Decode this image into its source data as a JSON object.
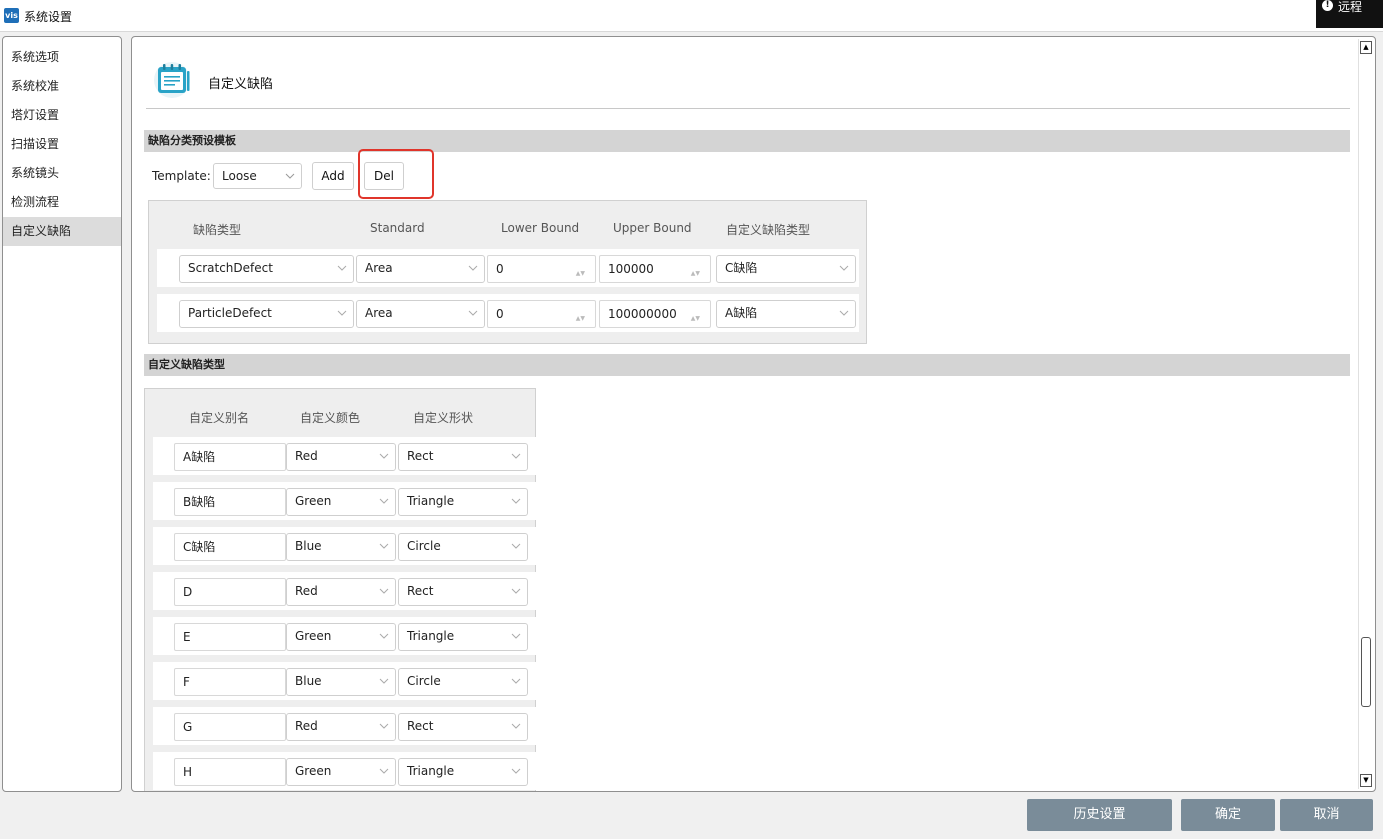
{
  "window": {
    "title": "系统设置",
    "app_icon": "vis",
    "remote_badge": "远程"
  },
  "nav": {
    "items": [
      "系统选项",
      "系统校准",
      "塔灯设置",
      "扫描设置",
      "系统镜头",
      "检测流程",
      "自定义缺陷"
    ],
    "active_index": 6
  },
  "header": {
    "title": "自定义缺陷",
    "icon": "notepad-icon"
  },
  "preset_section": {
    "title": "缺陷分类预设模板",
    "template_label": "Template:",
    "template_value": "Loose",
    "add_label": "Add",
    "del_label": "Del",
    "columns": [
      "缺陷类型",
      "Standard",
      "Lower Bound",
      "Upper Bound",
      "自定义缺陷类型"
    ],
    "rows": [
      {
        "defect_type": "ScratchDefect",
        "standard": "Area",
        "lower": "0",
        "upper": "100000",
        "custom_type": "C缺陷"
      },
      {
        "defect_type": "ParticleDefect",
        "standard": "Area",
        "lower": "0",
        "upper": "100000000",
        "custom_type": "A缺陷"
      }
    ]
  },
  "custom_section": {
    "title": "自定义缺陷类型",
    "columns": [
      "自定义别名",
      "自定义颜色",
      "自定义形状"
    ],
    "rows": [
      {
        "alias": "A缺陷",
        "color": "Red",
        "shape": "Rect"
      },
      {
        "alias": "B缺陷",
        "color": "Green",
        "shape": "Triangle"
      },
      {
        "alias": "C缺陷",
        "color": "Blue",
        "shape": "Circle"
      },
      {
        "alias": "D",
        "color": "Red",
        "shape": "Rect"
      },
      {
        "alias": "E",
        "color": "Green",
        "shape": "Triangle"
      },
      {
        "alias": "F",
        "color": "Blue",
        "shape": "Circle"
      },
      {
        "alias": "G",
        "color": "Red",
        "shape": "Rect"
      },
      {
        "alias": "H",
        "color": "Green",
        "shape": "Triangle"
      }
    ]
  },
  "footer": {
    "history_label": "历史设置",
    "ok_label": "确定",
    "cancel_label": "取消"
  },
  "colors": {
    "accent_button": "#7a8c99",
    "highlight": "#e0352b",
    "section_bar": "#d4d4d4"
  }
}
